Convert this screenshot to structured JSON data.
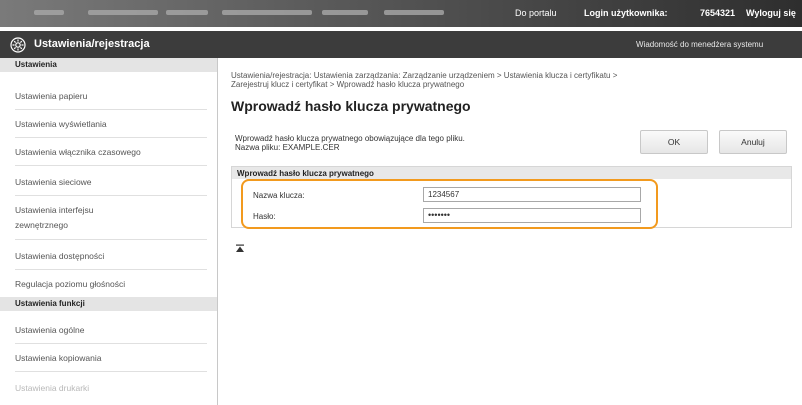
{
  "topbar": {
    "portal_link": "Do portalu",
    "login_label": "Login użytkownika:",
    "login_value": "7654321",
    "logout": "Wyloguj się"
  },
  "titlebar": {
    "title": "Ustawienia/rejestracja",
    "message": "Wiadomość do menedżera systemu"
  },
  "sidebar": {
    "section1": "Ustawienia",
    "items1": [
      "Ustawienia papieru",
      "Ustawienia wyświetlania",
      "Ustawienia włącznika czasowego",
      "Ustawienia sieciowe",
      "Ustawienia interfejsu zewnętrznego",
      "Ustawienia dostępności",
      "Regulacja poziomu głośności"
    ],
    "section2": "Ustawienia funkcji",
    "items2": [
      "Ustawienia ogólne",
      "Ustawienia kopiowania",
      "Ustawienia drukarki"
    ]
  },
  "main": {
    "breadcrumb_line1": "Ustawienia/rejestracja: Ustawienia zarządzania: Zarządzanie urządzeniem > Ustawienia klucza i certyfikatu >",
    "breadcrumb_line2": "Zarejestruj klucz i certyfikat > Wprowadź hasło klucza prywatnego",
    "heading": "Wprowadź hasło klucza prywatnego",
    "desc_line1": "Wprowadź hasło klucza prywatnego obowiązujące dla tego pliku.",
    "desc_line2": "Nazwa pliku: EXAMPLE.CER",
    "ok_label": "OK",
    "cancel_label": "Anuluj",
    "section_title": "Wprowadź hasło klucza prywatnego",
    "key_name_label": "Nazwa klucza:",
    "key_name_value": "1234567",
    "password_label": "Hasło:",
    "password_value": "•••••••"
  },
  "colors": {
    "highlight": "#f29a1e",
    "titlebar": "#3c3c3c"
  }
}
